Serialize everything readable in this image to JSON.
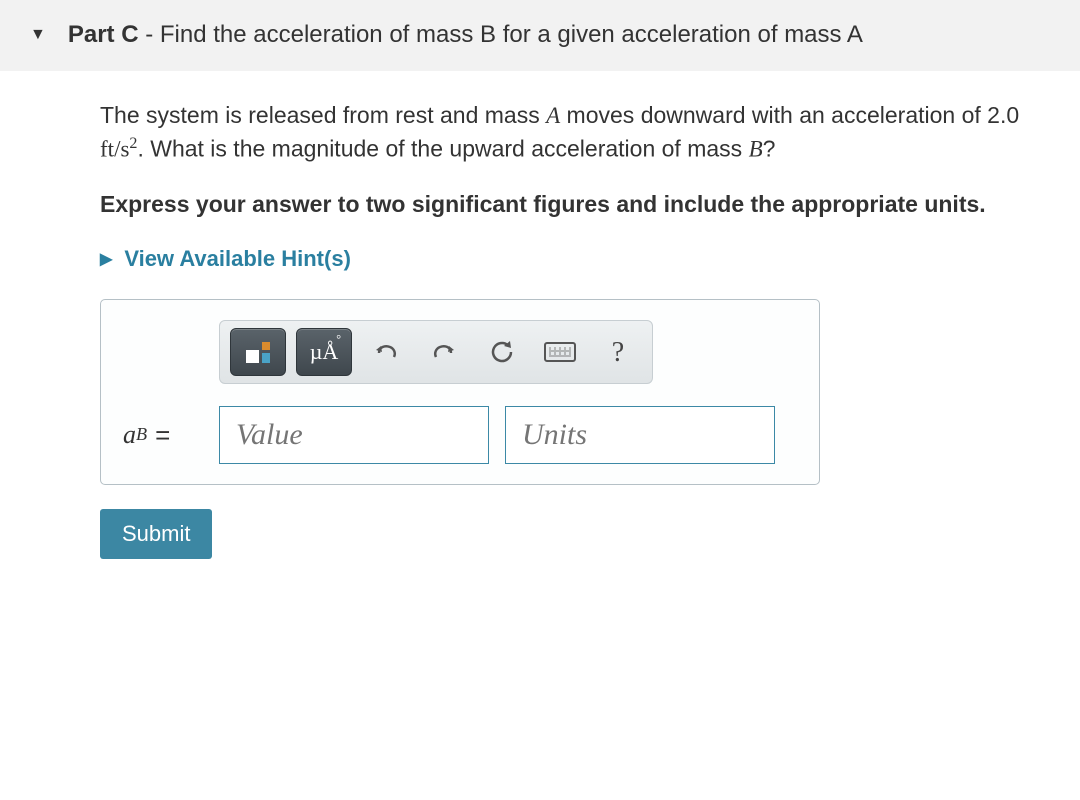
{
  "header": {
    "part_label": "Part C",
    "separator": " - ",
    "title": "Find the acceleration of mass B for a given acceleration of mass A"
  },
  "problem": {
    "pre": "The system is released from rest and mass ",
    "massA": "A",
    "mid1": " moves downward with an acceleration of 2.0 ",
    "unit_ft_s2_a": "ft",
    "unit_ft_s2_b": "/s",
    "unit_ft_s2_c": "2",
    "mid2": ". What is the magnitude of the upward acceleration of mass ",
    "massB": "B",
    "end": "?"
  },
  "instruction": "Express your answer to two significant figures and include the appropriate units.",
  "hints_label": "View Available Hint(s)",
  "toolbar": {
    "mua_label": "µÅ",
    "help_label": "?"
  },
  "answer": {
    "var_a": "a",
    "var_B": "B",
    "equals": " =",
    "value_placeholder": "Value",
    "units_placeholder": "Units"
  },
  "submit_label": "Submit"
}
